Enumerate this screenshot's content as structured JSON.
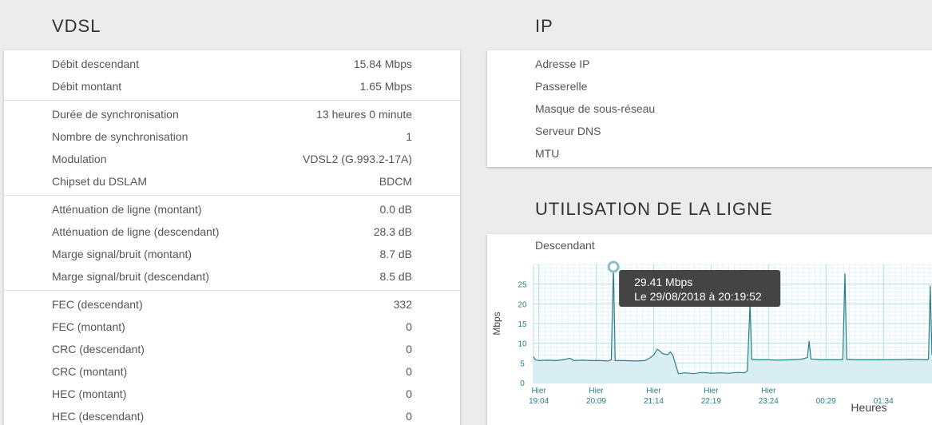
{
  "vdsl": {
    "title": "VDSL",
    "groups": [
      [
        {
          "label": "Débit descendant",
          "value": "15.84 Mbps"
        },
        {
          "label": "Débit montant",
          "value": "1.65 Mbps"
        }
      ],
      [
        {
          "label": "Durée de synchronisation",
          "value": "13 heures 0 minute"
        },
        {
          "label": "Nombre de synchronisation",
          "value": "1"
        },
        {
          "label": "Modulation",
          "value": "VDSL2 (G.993.2-17A)"
        },
        {
          "label": "Chipset du DSLAM",
          "value": "BDCM"
        }
      ],
      [
        {
          "label": "Atténuation de ligne (montant)",
          "value": "0.0 dB"
        },
        {
          "label": "Atténuation de ligne (descendant)",
          "value": "28.3 dB"
        },
        {
          "label": "Marge signal/bruit (montant)",
          "value": "8.7 dB"
        },
        {
          "label": "Marge signal/bruit (descendant)",
          "value": "8.5 dB"
        }
      ],
      [
        {
          "label": "FEC (descendant)",
          "value": "332"
        },
        {
          "label": "FEC (montant)",
          "value": "0"
        },
        {
          "label": "CRC (descendant)",
          "value": "0"
        },
        {
          "label": "CRC (montant)",
          "value": "0"
        },
        {
          "label": "HEC (montant)",
          "value": "0"
        },
        {
          "label": "HEC (descendant)",
          "value": "0"
        }
      ]
    ]
  },
  "ip": {
    "title": "IP",
    "rows": [
      {
        "label": "Adresse IP",
        "value": ""
      },
      {
        "label": "Passerelle",
        "value": ""
      },
      {
        "label": "Masque de sous-réseau",
        "value": ""
      },
      {
        "label": "Serveur DNS",
        "value": ""
      },
      {
        "label": "MTU",
        "value": ""
      }
    ]
  },
  "usage": {
    "title": "UTILISATION DE LA LIGNE",
    "subtitle": "Descendant",
    "tooltip": {
      "value": "29.41 Mbps",
      "date": "Le 29/08/2018 à 20:19:52"
    }
  },
  "chart_data": {
    "type": "area",
    "title": "Descendant",
    "xlabel": "Heures",
    "ylabel": "Mbps",
    "ylim": [
      0,
      30
    ],
    "yticks": [
      0,
      5,
      10,
      15,
      20,
      25
    ],
    "xticks": [
      {
        "t": 0,
        "l1": "Hier",
        "l2": "19:04"
      },
      {
        "t": 65,
        "l1": "Hier",
        "l2": "20:09"
      },
      {
        "t": 130,
        "l1": "Hier",
        "l2": "21:14"
      },
      {
        "t": 195,
        "l1": "Hier",
        "l2": "22:19"
      },
      {
        "t": 260,
        "l1": "Hier",
        "l2": "23:24"
      },
      {
        "t": 325,
        "l1": "",
        "l2": "00:29"
      },
      {
        "t": 390,
        "l1": "",
        "l2": "01:34"
      }
    ],
    "xrange": [
      -6,
      445
    ],
    "series": [
      {
        "name": "",
        "points": [
          [
            -6,
            6.6
          ],
          [
            -4,
            5.8
          ],
          [
            0,
            5.6
          ],
          [
            10,
            5.7
          ],
          [
            20,
            5.6
          ],
          [
            30,
            5.9
          ],
          [
            35,
            6.2
          ],
          [
            40,
            5.6
          ],
          [
            50,
            5.7
          ],
          [
            60,
            5.6
          ],
          [
            70,
            5.6
          ],
          [
            78,
            5.5
          ],
          [
            82,
            5.8
          ],
          [
            84.5,
            29.4
          ],
          [
            86.5,
            5.6
          ],
          [
            95,
            5.6
          ],
          [
            110,
            5.5
          ],
          [
            120,
            5.6
          ],
          [
            126,
            6.3
          ],
          [
            130,
            7.0
          ],
          [
            134,
            8.5
          ],
          [
            137,
            8.0
          ],
          [
            140,
            7.4
          ],
          [
            143,
            7.2
          ],
          [
            146,
            7.1
          ],
          [
            149,
            7.8
          ],
          [
            152,
            6.8
          ],
          [
            155,
            4.5
          ],
          [
            158,
            2.3
          ],
          [
            165,
            2.5
          ],
          [
            175,
            2.3
          ],
          [
            185,
            2.6
          ],
          [
            195,
            2.4
          ],
          [
            205,
            2.5
          ],
          [
            215,
            2.4
          ],
          [
            225,
            2.6
          ],
          [
            233,
            2.5
          ],
          [
            236,
            3.0
          ],
          [
            239,
            19.9
          ],
          [
            241,
            5.9
          ],
          [
            250,
            5.8
          ],
          [
            260,
            5.8
          ],
          [
            270,
            5.7
          ],
          [
            285,
            5.8
          ],
          [
            295,
            5.9
          ],
          [
            300,
            6.1
          ],
          [
            304,
            6.4
          ],
          [
            306,
            10.6
          ],
          [
            308,
            6.0
          ],
          [
            320,
            5.8
          ],
          [
            330,
            5.8
          ],
          [
            340,
            5.8
          ],
          [
            344,
            5.9
          ],
          [
            346.5,
            27.7
          ],
          [
            348.5,
            5.9
          ],
          [
            360,
            5.8
          ],
          [
            380,
            5.8
          ],
          [
            400,
            5.8
          ],
          [
            420,
            5.9
          ],
          [
            440,
            5.8
          ],
          [
            441,
            6.0
          ],
          [
            443,
            24.6
          ],
          [
            445,
            7.0
          ]
        ]
      }
    ],
    "highlight": {
      "x": 84.5,
      "y": 29.4
    },
    "colors": {
      "line": "#2a7f86",
      "fill": "#d9eef3",
      "grid": "#b8e0ea"
    }
  }
}
